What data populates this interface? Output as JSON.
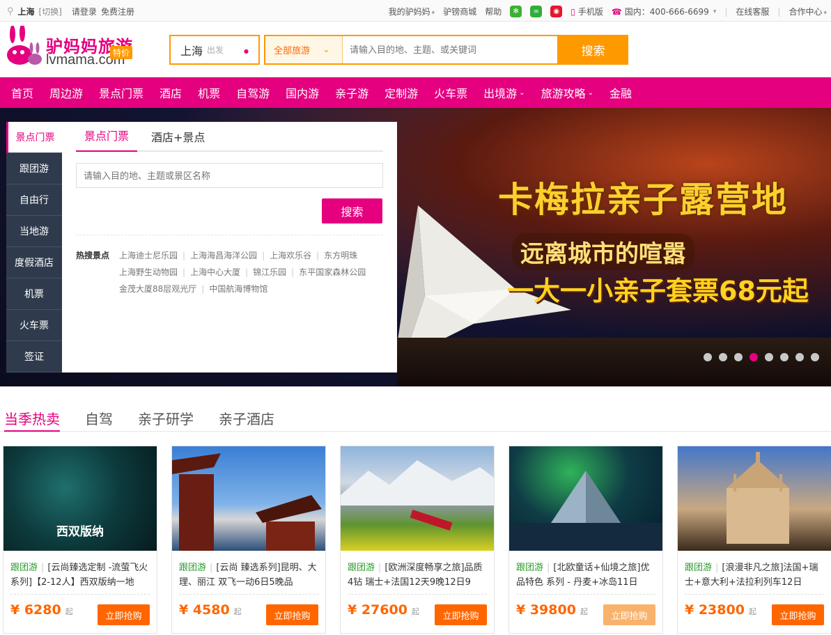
{
  "topbar": {
    "city": "上海",
    "switch": "[切换]",
    "login": "请登录",
    "register": "免费注册",
    "my_lvmama": "我的驴妈妈",
    "mall": "驴镑商城",
    "help": "帮助",
    "mobile": "手机版",
    "hotline": "国内：400-666-6699",
    "service": "在线客服",
    "partner": "合作中心"
  },
  "header": {
    "logo_cn": "驴妈妈旅游",
    "logo_en": "lvmama.com",
    "badge": "特价",
    "depart_city": "上海",
    "depart_label": "出发",
    "search_category": "全部旅游",
    "search_placeholder": "请输入目的地、主题、或关键词",
    "search_button": "搜索"
  },
  "nav": [
    "首页",
    "周边游",
    "景点门票",
    "酒店",
    "机票",
    "自驾游",
    "国内游",
    "亲子游",
    "定制游",
    "火车票",
    "出境游",
    "旅游攻略",
    "金融"
  ],
  "sidemenu": [
    "景点门票",
    "跟团游",
    "自由行",
    "当地游",
    "度假酒店",
    "机票",
    "火车票",
    "签证"
  ],
  "panel": {
    "tab1": "景点门票",
    "tab2": "酒店+景点",
    "placeholder": "请输入目的地、主题或景区名称",
    "button": "搜索",
    "hot_label": "热搜景点",
    "hot": [
      "上海迪士尼乐园",
      "上海海昌海洋公园",
      "上海欢乐谷",
      "东方明珠",
      "上海野生动物园",
      "上海中心大厦",
      "锦江乐园",
      "东平国家森林公园",
      "金茂大厦88层观光厅",
      "中国航海博物馆"
    ]
  },
  "banner": {
    "line1": "卡梅拉亲子露营地",
    "line2": "远离城市的喧嚣",
    "line3": "一大一小亲子套票68元起",
    "slides": 8,
    "active_slide": 4
  },
  "section_tabs": [
    "当季热卖",
    "自驾",
    "亲子研学",
    "亲子酒店"
  ],
  "cards": [
    {
      "tag": "跟团游",
      "title": "[云尚臻选定制 -流萤飞火系列]【2-12人】西双版纳一地",
      "price": "¥ 6280",
      "qi": "起",
      "buy": "立即抢购",
      "img_text": "西双版纳"
    },
    {
      "tag": "跟团游",
      "title": "[云尚 臻选系列]昆明、大理、丽江 双飞一动6日5晚品",
      "price": "¥ 4580",
      "qi": "起",
      "buy": "立即抢购",
      "img_text": ""
    },
    {
      "tag": "跟团游",
      "title": "[欧洲深度畅享之旅]品质4钻 瑞士+法国12天9晚12日9",
      "price": "¥ 27600",
      "qi": "起",
      "buy": "立即抢购",
      "img_text": ""
    },
    {
      "tag": "跟团游",
      "title": "[北欧童话+仙境之旅]优品特色 系列 - 丹麦+冰岛11日",
      "price": "¥ 39800",
      "qi": "起",
      "buy": "立即抢购",
      "img_text": ""
    },
    {
      "tag": "跟团游",
      "title": "[浪漫非凡之旅]法国+瑞士+意大利+法拉利列车12日",
      "price": "¥ 23800",
      "qi": "起",
      "buy": "立即抢购",
      "img_text": ""
    }
  ]
}
